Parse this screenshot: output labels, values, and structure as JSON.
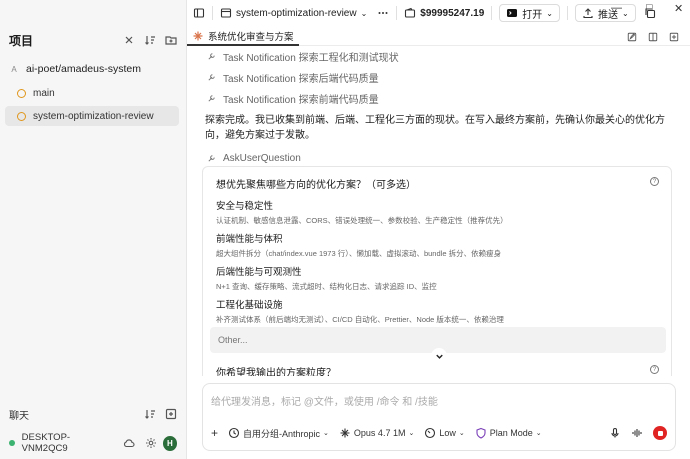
{
  "sidebar": {
    "title": "项目",
    "repo": "ai-poet/amadeus-system",
    "repo_letter": "A",
    "branches": [
      {
        "label": "main",
        "active": false
      },
      {
        "label": "system-optimization-review",
        "active": true
      }
    ],
    "chat_label": "聊天",
    "machine": "DESKTOP-VNM2QC9",
    "avatar_letter": "H"
  },
  "topbar": {
    "branch": "system-optimization-review",
    "price": "$99995247.19",
    "open_label": "打开",
    "push_label": "推送",
    "win_min": "—",
    "win_max": "□",
    "win_close": "✕"
  },
  "tab": {
    "label": "系统优化审查与方案"
  },
  "main": {
    "tool_lines": [
      "Task Notification  探索工程化和测试现状",
      "Task Notification  探索后端代码质量",
      "Task Notification  探索前端代码质量"
    ],
    "paragraph": "探索完成。我已收集到前端、后端、工程化三方面的现状。在写入最终方案前，先确认你最关心的优化方向，避免方案过于发散。",
    "ask_label": "AskUserQuestion",
    "question1": "想优先聚焦哪些方向的优化方案？（可多选）",
    "options": [
      {
        "title": "安全与稳定性",
        "desc": "认证机制、敏感信息泄露、CORS、错误处理统一、参数校验、生产稳定性（推荐优先）"
      },
      {
        "title": "前端性能与体积",
        "desc": "超大组件拆分（chat/index.vue 1973 行）、懒加载、虚拟滚动、bundle 拆分、依赖瘦身"
      },
      {
        "title": "后端性能与可观测性",
        "desc": "N+1 查询、缓存策略、流式超时、结构化日志、请求追踪 ID、监控"
      },
      {
        "title": "工程化基础设施",
        "desc": "补齐测试体系（前后端均无测试）、CI/CD 自动化、Prettier、Node 版本统一、依赖治理"
      }
    ],
    "other_placeholder": "Other...",
    "question2": "你希望我输出的方案粒度？"
  },
  "input": {
    "placeholder": "给代理发消息，标记 @文件，或使用 /命令 和 /技能",
    "add": "+",
    "group": "自用分组-Anthropic",
    "model": "Opus 4.7 1M",
    "effort": "Low",
    "mode": "Plan Mode"
  },
  "colors": {
    "accent_purple": "#7a3fb8",
    "stop_red": "#e02424",
    "branch_orange": "#e0961c",
    "online_green": "#3cb371",
    "avatar_green": "#2b6d3a"
  }
}
